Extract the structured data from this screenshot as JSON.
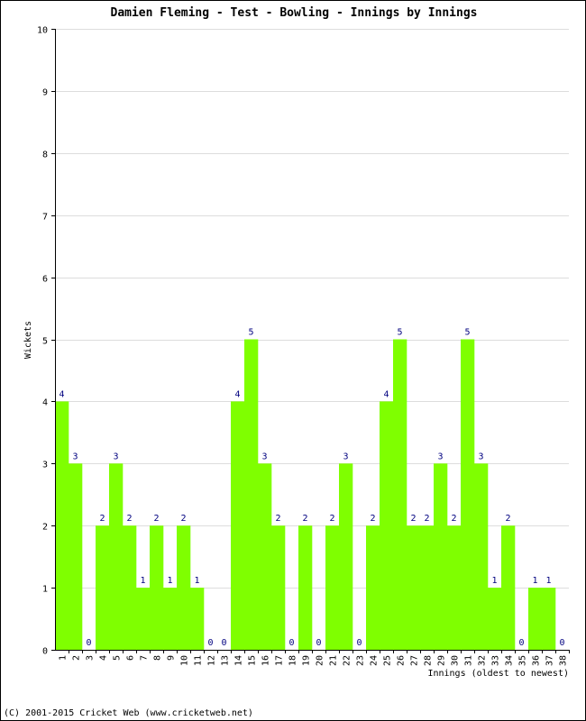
{
  "footer": "(C) 2001-2015 Cricket Web (www.cricketweb.net)",
  "colors": {
    "bar": "#7fff00",
    "grid": "#dddddd",
    "data_label": "#000080",
    "axis": "#000000"
  },
  "chart_data": {
    "type": "bar",
    "title": "Damien Fleming - Test - Bowling - Innings by Innings",
    "xlabel": "Innings (oldest to newest)",
    "ylabel": "Wickets",
    "ylim": [
      0,
      10
    ],
    "yticks": [
      0,
      1,
      2,
      3,
      4,
      5,
      6,
      7,
      8,
      9,
      10
    ],
    "grid": true,
    "categories": [
      "1",
      "2",
      "3",
      "4",
      "5",
      "6",
      "7",
      "8",
      "9",
      "10",
      "11",
      "12",
      "13",
      "14",
      "15",
      "16",
      "17",
      "18",
      "19",
      "20",
      "21",
      "22",
      "23",
      "24",
      "25",
      "26",
      "27",
      "28",
      "29",
      "30",
      "31",
      "32",
      "33",
      "34",
      "35",
      "36",
      "37",
      "38"
    ],
    "values": [
      4,
      3,
      0,
      2,
      3,
      2,
      1,
      2,
      1,
      2,
      1,
      0,
      0,
      4,
      5,
      3,
      2,
      0,
      2,
      0,
      2,
      3,
      0,
      2,
      4,
      5,
      2,
      2,
      3,
      2,
      5,
      3,
      1,
      2,
      0,
      1,
      1,
      0
    ]
  }
}
